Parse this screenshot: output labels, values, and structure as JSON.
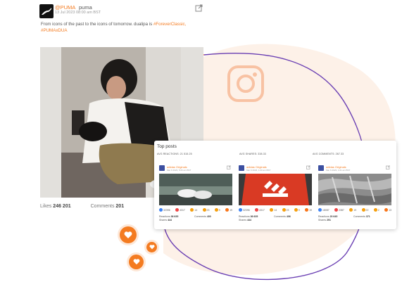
{
  "post": {
    "handle": "@PUMA",
    "name": "puma",
    "date": "13 Jul 2023 08:00 am BST",
    "text_plain": "From icons of the past to the icons of tomorrow. dualipa is",
    "hashtag_1": "#ForeverClassic",
    "hashtag_1_suffix": ",",
    "hashtag_2": "#PUMAxDUA",
    "likes_label": "Likes",
    "likes_value": "246 201",
    "comments_label": "Comments",
    "comments_value": "201"
  },
  "panel": {
    "title": "Top posts",
    "columns": [
      {
        "label": "AVG REACTIONS: 21 515.25",
        "account": "adidas Originals",
        "date": "Mar 6 2023, 5:06 am BST",
        "reactions": [
          "32396",
          "4317",
          "14",
          "23",
          "9",
          "19"
        ],
        "reactions_label": "Reactions",
        "reactions_value": "36 635",
        "comments_label": "Comments",
        "comments_value": "400",
        "shares_label": "Shares",
        "shares_value": "444"
      },
      {
        "label": "AVG SHARES: 338.33",
        "account": "adidas Originals",
        "date": "Mar 6 2023, 1:00 am BST",
        "reactions": [
          "32396",
          "4317",
          "14",
          "23",
          "9",
          "19"
        ],
        "reactions_label": "Reactions",
        "reactions_value": "36 635",
        "comments_label": "Comments",
        "comments_value": "406",
        "shares_label": "Shares",
        "shares_value": "444"
      },
      {
        "label": "AVG COMMENTS: 267.33",
        "account": "adidas Originals",
        "date": "Mar 6 2023, 1:01 am BST",
        "reactions": [
          "18087",
          "2387",
          "19",
          "22",
          "2",
          "13"
        ],
        "reactions_label": "Reactions",
        "reactions_value": "20 645",
        "comments_label": "Comments",
        "comments_value": "371",
        "shares_label": "Shares",
        "shares_value": "291"
      }
    ],
    "reaction_colors": [
      "#3b82f6",
      "#ef4444",
      "#f59e0b",
      "#f59e0b",
      "#f59e0b",
      "#f97316"
    ],
    "reaction_icons": [
      "like-icon",
      "love-icon",
      "haha-icon",
      "wow-icon",
      "sad-icon",
      "angry-icon"
    ]
  },
  "colors": {
    "accent": "#f47b20",
    "facebook_blue": "#3b82f6",
    "wave_purple": "#6a3fb3"
  },
  "icons": {
    "brand": "puma-logo-icon",
    "external": "external-link-icon",
    "instagram": "instagram-icon",
    "heart": "heart-icon"
  }
}
